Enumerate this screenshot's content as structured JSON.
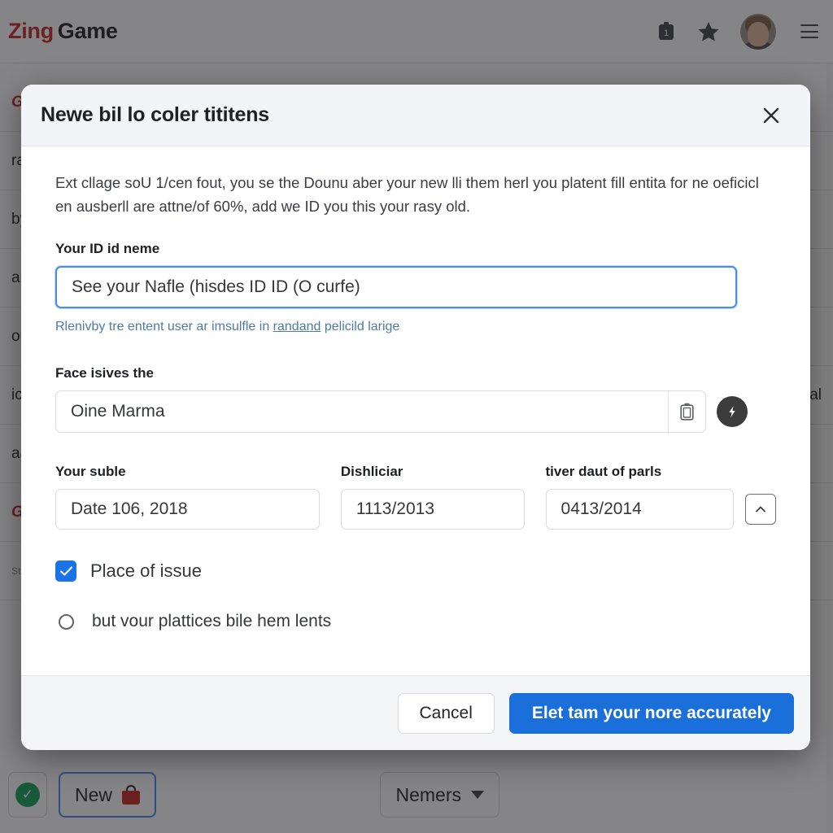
{
  "background": {
    "brand_first": "Zing",
    "brand_second": "Game",
    "header_icons": [
      {
        "name": "calendar-icon",
        "glyph": "1"
      },
      {
        "name": "star-icon",
        "glyph": "★"
      }
    ],
    "avatar_label": "account-avatar",
    "menu_label": "menu-icon",
    "rows": [
      {
        "text": "Gener",
        "style": "accent"
      },
      {
        "text": "rating",
        "style": "normal",
        "right": ""
      },
      {
        "text": "by",
        "style": "normal",
        "right": ""
      },
      {
        "text": "and",
        "style": "normal",
        "right": ""
      },
      {
        "text": "ou l",
        "style": "normal",
        "right": ""
      },
      {
        "text": "ice",
        "style": "normal",
        "right": "cal"
      },
      {
        "text": "aar",
        "style": "normal",
        "right": ""
      },
      {
        "text": "Gener",
        "style": "accent",
        "right": ""
      },
      {
        "text": "Stat",
        "style": "small",
        "right": ""
      }
    ],
    "bottom_bar": {
      "new_button": "New",
      "new_button_icon": "bag-icon",
      "green_check": "✓",
      "members_button": "Nemers",
      "members_caret": "chevron-down-icon"
    }
  },
  "modal": {
    "title": "Newe bil lo coler tititens",
    "close_icon": "close-icon",
    "intro": "Ext cllage soU 1/cen fout, you se the Dounu aber your new lli them herl you platent fill entita for ne oeficicl en ausberll are attne/of 60%, add we ID you this your rasy old.",
    "field_id": {
      "label": "Your ID id neme",
      "value": "See your Nafle (hisdes ID ID (O curfe)",
      "helper_prefix": "Rlenivby tre entent user ar imsulfle in ",
      "helper_link": "randand",
      "helper_suffix": " pelicild larige"
    },
    "field_face": {
      "label": "Face isives the",
      "value": "Oine Marma",
      "copy_icon": "clipboard-icon",
      "action_icon": "bolt-icon"
    },
    "date_fields": [
      {
        "label": "Your suble",
        "value": "Date 106, 2018"
      },
      {
        "label": "Dishliciar",
        "value": "1113/2013"
      },
      {
        "label": "tiver daut of parls",
        "value": "0413/2014"
      }
    ],
    "stepper_icon": "chevron-up-icon",
    "checkbox": {
      "label": "Place of issue",
      "checked": true,
      "check_glyph": "✓"
    },
    "radio": {
      "label": "but vour plattices bile hem lents",
      "selected": false
    },
    "footer": {
      "cancel_label": "Cancel",
      "submit_label": "Elet tam your nore accurately"
    }
  },
  "colors": {
    "primary": "#1a6fdb",
    "accent_red": "#c5221f",
    "checkbox_blue": "#1a73e8",
    "focus_blue": "#4a90e2",
    "link_blue": "#4c7ca3"
  }
}
